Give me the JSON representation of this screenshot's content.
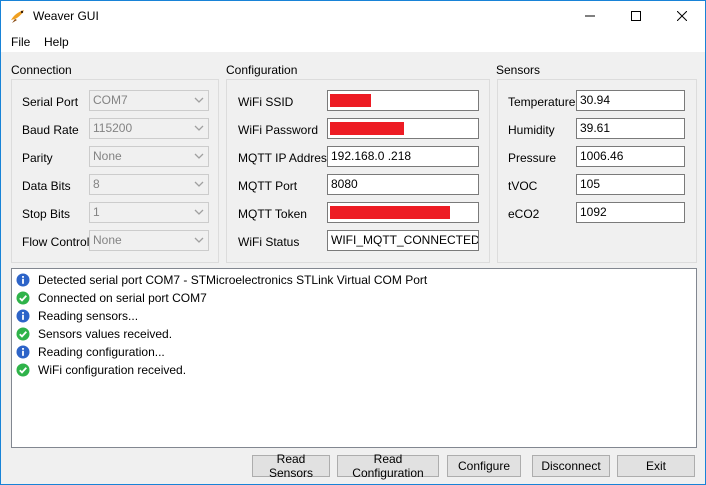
{
  "window": {
    "title": "Weaver GUI"
  },
  "menu": {
    "file": "File",
    "help": "Help"
  },
  "connection": {
    "title": "Connection",
    "rows": [
      {
        "label": "Serial Port",
        "value": "COM7"
      },
      {
        "label": "Baud Rate",
        "value": "115200"
      },
      {
        "label": "Parity",
        "value": "None"
      },
      {
        "label": "Data Bits",
        "value": "8"
      },
      {
        "label": "Stop Bits",
        "value": "1"
      },
      {
        "label": "Flow Control",
        "value": "None"
      }
    ]
  },
  "configuration": {
    "title": "Configuration",
    "rows": [
      {
        "label": "WiFi SSID",
        "value": "",
        "redacted": true
      },
      {
        "label": "WiFi Password",
        "value": "",
        "redacted": true
      },
      {
        "label": "MQTT IP Address",
        "value": "192.168.0 .218"
      },
      {
        "label": "MQTT Port",
        "value": "8080"
      },
      {
        "label": "MQTT Token",
        "value": "",
        "redacted": true
      },
      {
        "label": "WiFi Status",
        "value": "WIFI_MQTT_CONNECTED"
      }
    ]
  },
  "sensors": {
    "title": "Sensors",
    "rows": [
      {
        "label": "Temperature",
        "value": "30.94"
      },
      {
        "label": "Humidity",
        "value": "39.61"
      },
      {
        "label": "Pressure",
        "value": "1006.46"
      },
      {
        "label": "tVOC",
        "value": "105"
      },
      {
        "label": "eCO2",
        "value": "1092"
      }
    ]
  },
  "log": [
    {
      "type": "info",
      "icon": "info-icon",
      "text": "Detected serial port COM7 - STMicroelectronics STLink Virtual COM Port"
    },
    {
      "type": "success",
      "icon": "check-icon",
      "text": "Connected on serial port COM7"
    },
    {
      "type": "info",
      "icon": "info-icon",
      "text": "Reading sensors..."
    },
    {
      "type": "success",
      "icon": "check-icon",
      "text": "Sensors values received."
    },
    {
      "type": "info",
      "icon": "info-icon",
      "text": "Reading configuration..."
    },
    {
      "type": "success",
      "icon": "check-icon",
      "text": "WiFi configuration received."
    }
  ],
  "buttons": {
    "read_sensors": "Read Sensors",
    "read_configuration": "Read Configuration",
    "configure": "Configure",
    "disconnect": "Disconnect",
    "exit": "Exit"
  },
  "colors": {
    "info": "#2d64c8",
    "success": "#2fb34a",
    "redaction": "#ed1c24",
    "titlebar_border": "#1883d7"
  }
}
